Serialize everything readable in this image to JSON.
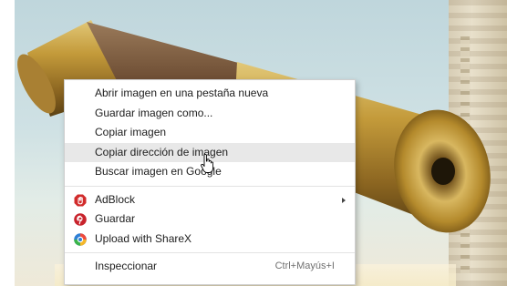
{
  "context_menu": {
    "items": [
      {
        "label": "Abrir imagen en una pestaña nueva"
      },
      {
        "label": "Guardar imagen como..."
      },
      {
        "label": "Copiar imagen"
      },
      {
        "label": "Copiar dirección de imagen",
        "state": "hovered"
      },
      {
        "label": "Buscar imagen en Google"
      }
    ],
    "extension_items": [
      {
        "label": "AdBlock",
        "icon": "adblock-icon",
        "has_submenu": true
      },
      {
        "label": "Guardar",
        "icon": "pinterest-icon"
      },
      {
        "label": "Upload with ShareX",
        "icon": "sharex-icon"
      }
    ],
    "inspect": {
      "label": "Inspeccionar",
      "shortcut": "Ctrl+Mayús+I"
    }
  },
  "colors": {
    "adblock": "#d12b2b",
    "pinterest": "#c8232c",
    "menu_hover": "#e8e8e8",
    "telescope_brass": "#b48a2c"
  }
}
